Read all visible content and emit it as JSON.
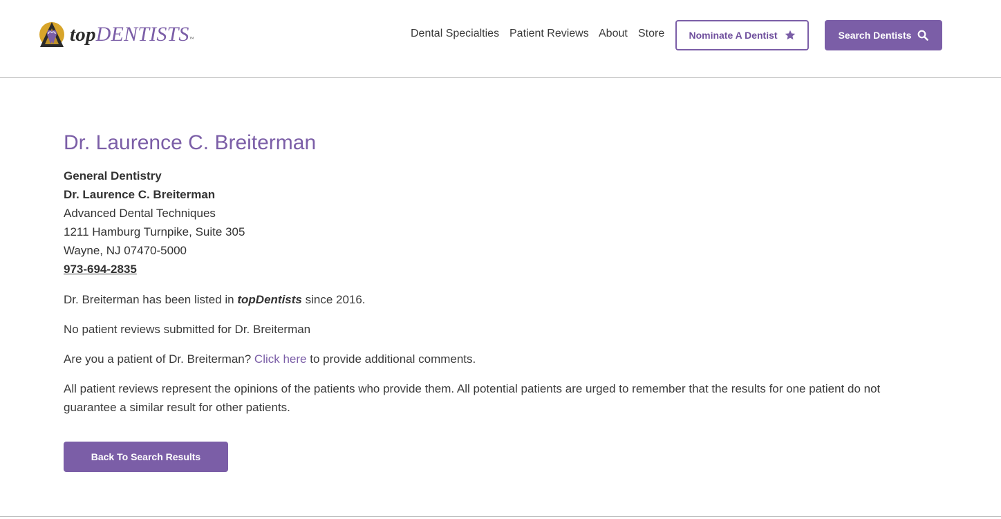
{
  "header": {
    "logo": {
      "top": "top",
      "dentists": "DENTISTS",
      "tm": "™"
    },
    "nav": [
      {
        "label": "Dental Specialties"
      },
      {
        "label": "Patient Reviews"
      },
      {
        "label": "About"
      },
      {
        "label": "Store"
      }
    ],
    "nominate_label": "Nominate A Dentist",
    "nominate_icon": "star-icon",
    "search_label": "Search Dentists",
    "search_icon": "search-icon"
  },
  "profile": {
    "title": "Dr. Laurence C. Breiterman",
    "specialty": "General Dentistry",
    "name": "Dr. Laurence C. Breiterman",
    "practice": "Advanced Dental Techniques",
    "address1": "1211 Hamburg Turnpike, Suite 305",
    "address2": "Wayne, NJ 07470-5000",
    "phone": "973-694-2835"
  },
  "content": {
    "listed_pre": "Dr. Breiterman has been listed in ",
    "listed_brand": "topDentists",
    "listed_post": " since 2016.",
    "no_reviews": "No patient reviews submitted for Dr. Breiterman",
    "patient_pre": "Are you a patient of Dr. Breiterman? ",
    "patient_link": "Click here",
    "patient_post": " to provide additional comments.",
    "disclaimer": "All patient reviews represent the opinions of the patients who provide them. All potential patients are urged to remember that the results for one patient do not guarantee a similar result for other patients."
  },
  "back_button_label": "Back To Search Results",
  "colors": {
    "accent": "#7b5ea7",
    "text": "#333333",
    "rule": "#bdbdbd"
  }
}
